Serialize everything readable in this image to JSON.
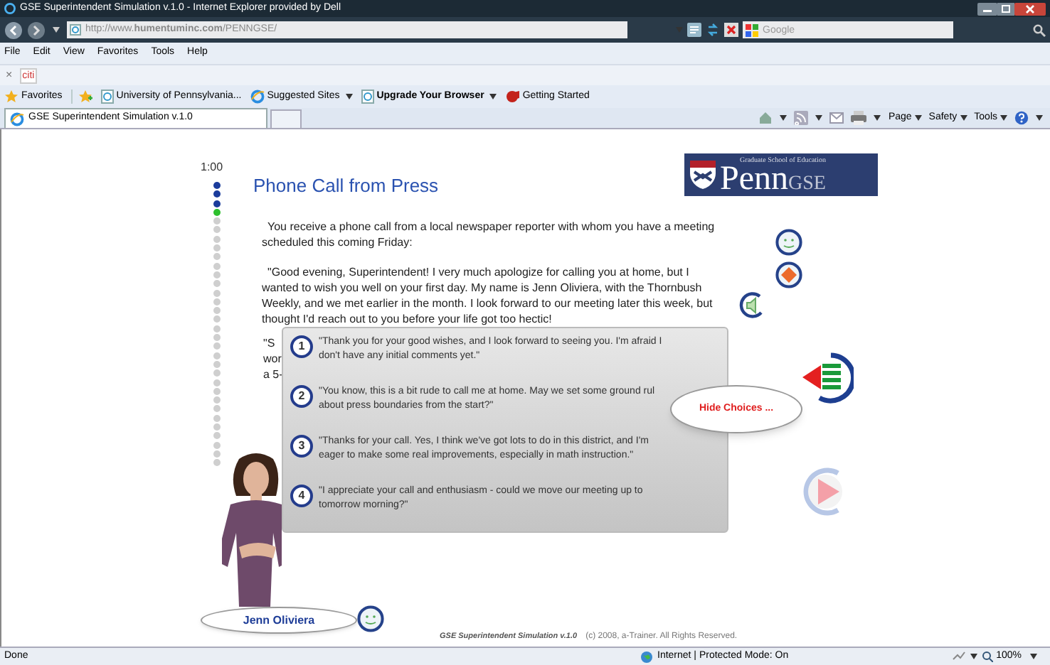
{
  "window": {
    "title": "GSE Superintendent Simulation v.1.0 - Internet Explorer provided by Dell"
  },
  "address_bar": {
    "url": "http://www.**humentuminc.com**/PENNGSE/"
  },
  "search": {
    "placeholder": "Google"
  },
  "menu": [
    "File",
    "Edit",
    "View",
    "Favorites",
    "Tools",
    "Help"
  ],
  "find_bar": {
    "close": "×",
    "value": "citi"
  },
  "favorites_bar": [
    {
      "label": "Favorites",
      "kind": "star",
      "dropdown": false,
      "emphasized": false
    },
    {
      "label": "University of Pennsylvania...",
      "kind": "page",
      "dropdown": false,
      "emphasized": false
    },
    {
      "label": "Suggested Sites",
      "kind": "ie",
      "dropdown": true,
      "emphasized": false
    },
    {
      "label": "Upgrade Your Browser",
      "kind": "page",
      "dropdown": true,
      "emphasized": true
    },
    {
      "label": "Getting Started",
      "kind": "flag",
      "dropdown": false,
      "emphasized": false
    }
  ],
  "tabs": [
    {
      "label": "GSE Superintendent Simulation v.1.0",
      "selected": true
    }
  ],
  "command_bar": [
    "Page",
    "Safety",
    "Tools"
  ],
  "simulation": {
    "timer": "1:00",
    "progress": [
      {
        "completed": true,
        "current": false
      },
      {
        "completed": true,
        "current": false
      },
      {
        "completed": true,
        "current": false
      },
      {
        "completed": false,
        "current": true
      },
      {
        "completed": false,
        "current": false
      },
      {
        "completed": false,
        "current": false
      },
      {
        "completed": false,
        "current": false
      },
      {
        "completed": false,
        "current": false
      },
      {
        "completed": false,
        "current": false
      },
      {
        "completed": false,
        "current": false
      },
      {
        "completed": false,
        "current": false
      },
      {
        "completed": false,
        "current": false
      },
      {
        "completed": false,
        "current": false
      },
      {
        "completed": false,
        "current": false
      },
      {
        "completed": false,
        "current": false
      },
      {
        "completed": false,
        "current": false
      },
      {
        "completed": false,
        "current": false
      },
      {
        "completed": false,
        "current": false
      },
      {
        "completed": false,
        "current": false
      },
      {
        "completed": false,
        "current": false
      },
      {
        "completed": false,
        "current": false
      },
      {
        "completed": false,
        "current": false
      },
      {
        "completed": false,
        "current": false
      },
      {
        "completed": false,
        "current": false
      },
      {
        "completed": false,
        "current": false
      },
      {
        "completed": false,
        "current": false
      },
      {
        "completed": false,
        "current": false
      },
      {
        "completed": false,
        "current": false
      },
      {
        "completed": false,
        "current": false
      },
      {
        "completed": false,
        "current": false
      },
      {
        "completed": false,
        "current": false
      },
      {
        "completed": false,
        "current": false
      }
    ],
    "title": "Phone Call from Press",
    "logo": {
      "caption": "Graduate School of Education",
      "name": "Penn",
      "suffix": "GSE"
    },
    "paragraphs": [
      "You receive a phone call from a local newspaper reporter with whom you have a meeting scheduled this coming Friday:",
      "\"Good evening, Superintendent!  I very much apologize for calling you at home, but I wanted to wish you well on your first day.  My name is Jenn Oliviera, with the Thornbush Weekly, and we met earlier in the month.  I look forward to our meeting later this week, but thought I'd reach out to you before your life got too hectic!"
    ],
    "hidden_paragraph_fragments": [
      "\"S",
      "wor",
      "a 5-"
    ],
    "choices": [
      {
        "number": "1",
        "lines": [
          "\"Thank you for your good wishes, and I look forward to seeing you. I'm afraid I",
          "don't have any initial comments yet.\""
        ]
      },
      {
        "number": "2",
        "lines": [
          "\"You know, this is a bit rude to call me at home.  May we set some ground rul",
          "about press boundaries from the start?\""
        ]
      },
      {
        "number": "3",
        "lines": [
          "\"Thanks for your call.  Yes, I think we've got lots to do in this district, and I'm",
          "eager to make some real improvements, especially in math instruction.\""
        ]
      },
      {
        "number": "4",
        "lines": [
          "\"I appreciate your call and enthusiasm - could we move our meeting up to",
          "tomorrow morning?\""
        ]
      }
    ],
    "hide_choices": "Hide Choices ...",
    "character": {
      "name": "Jenn Oliviera"
    },
    "footer": {
      "title": "GSE Superintendent Simulation v.1.0",
      "copyright": "(c) 2008, a-Trainer. All Rights Reserved."
    }
  },
  "status_bar": {
    "text": "Done",
    "zone": "Internet | Protected Mode: On",
    "zoom": "100%"
  }
}
